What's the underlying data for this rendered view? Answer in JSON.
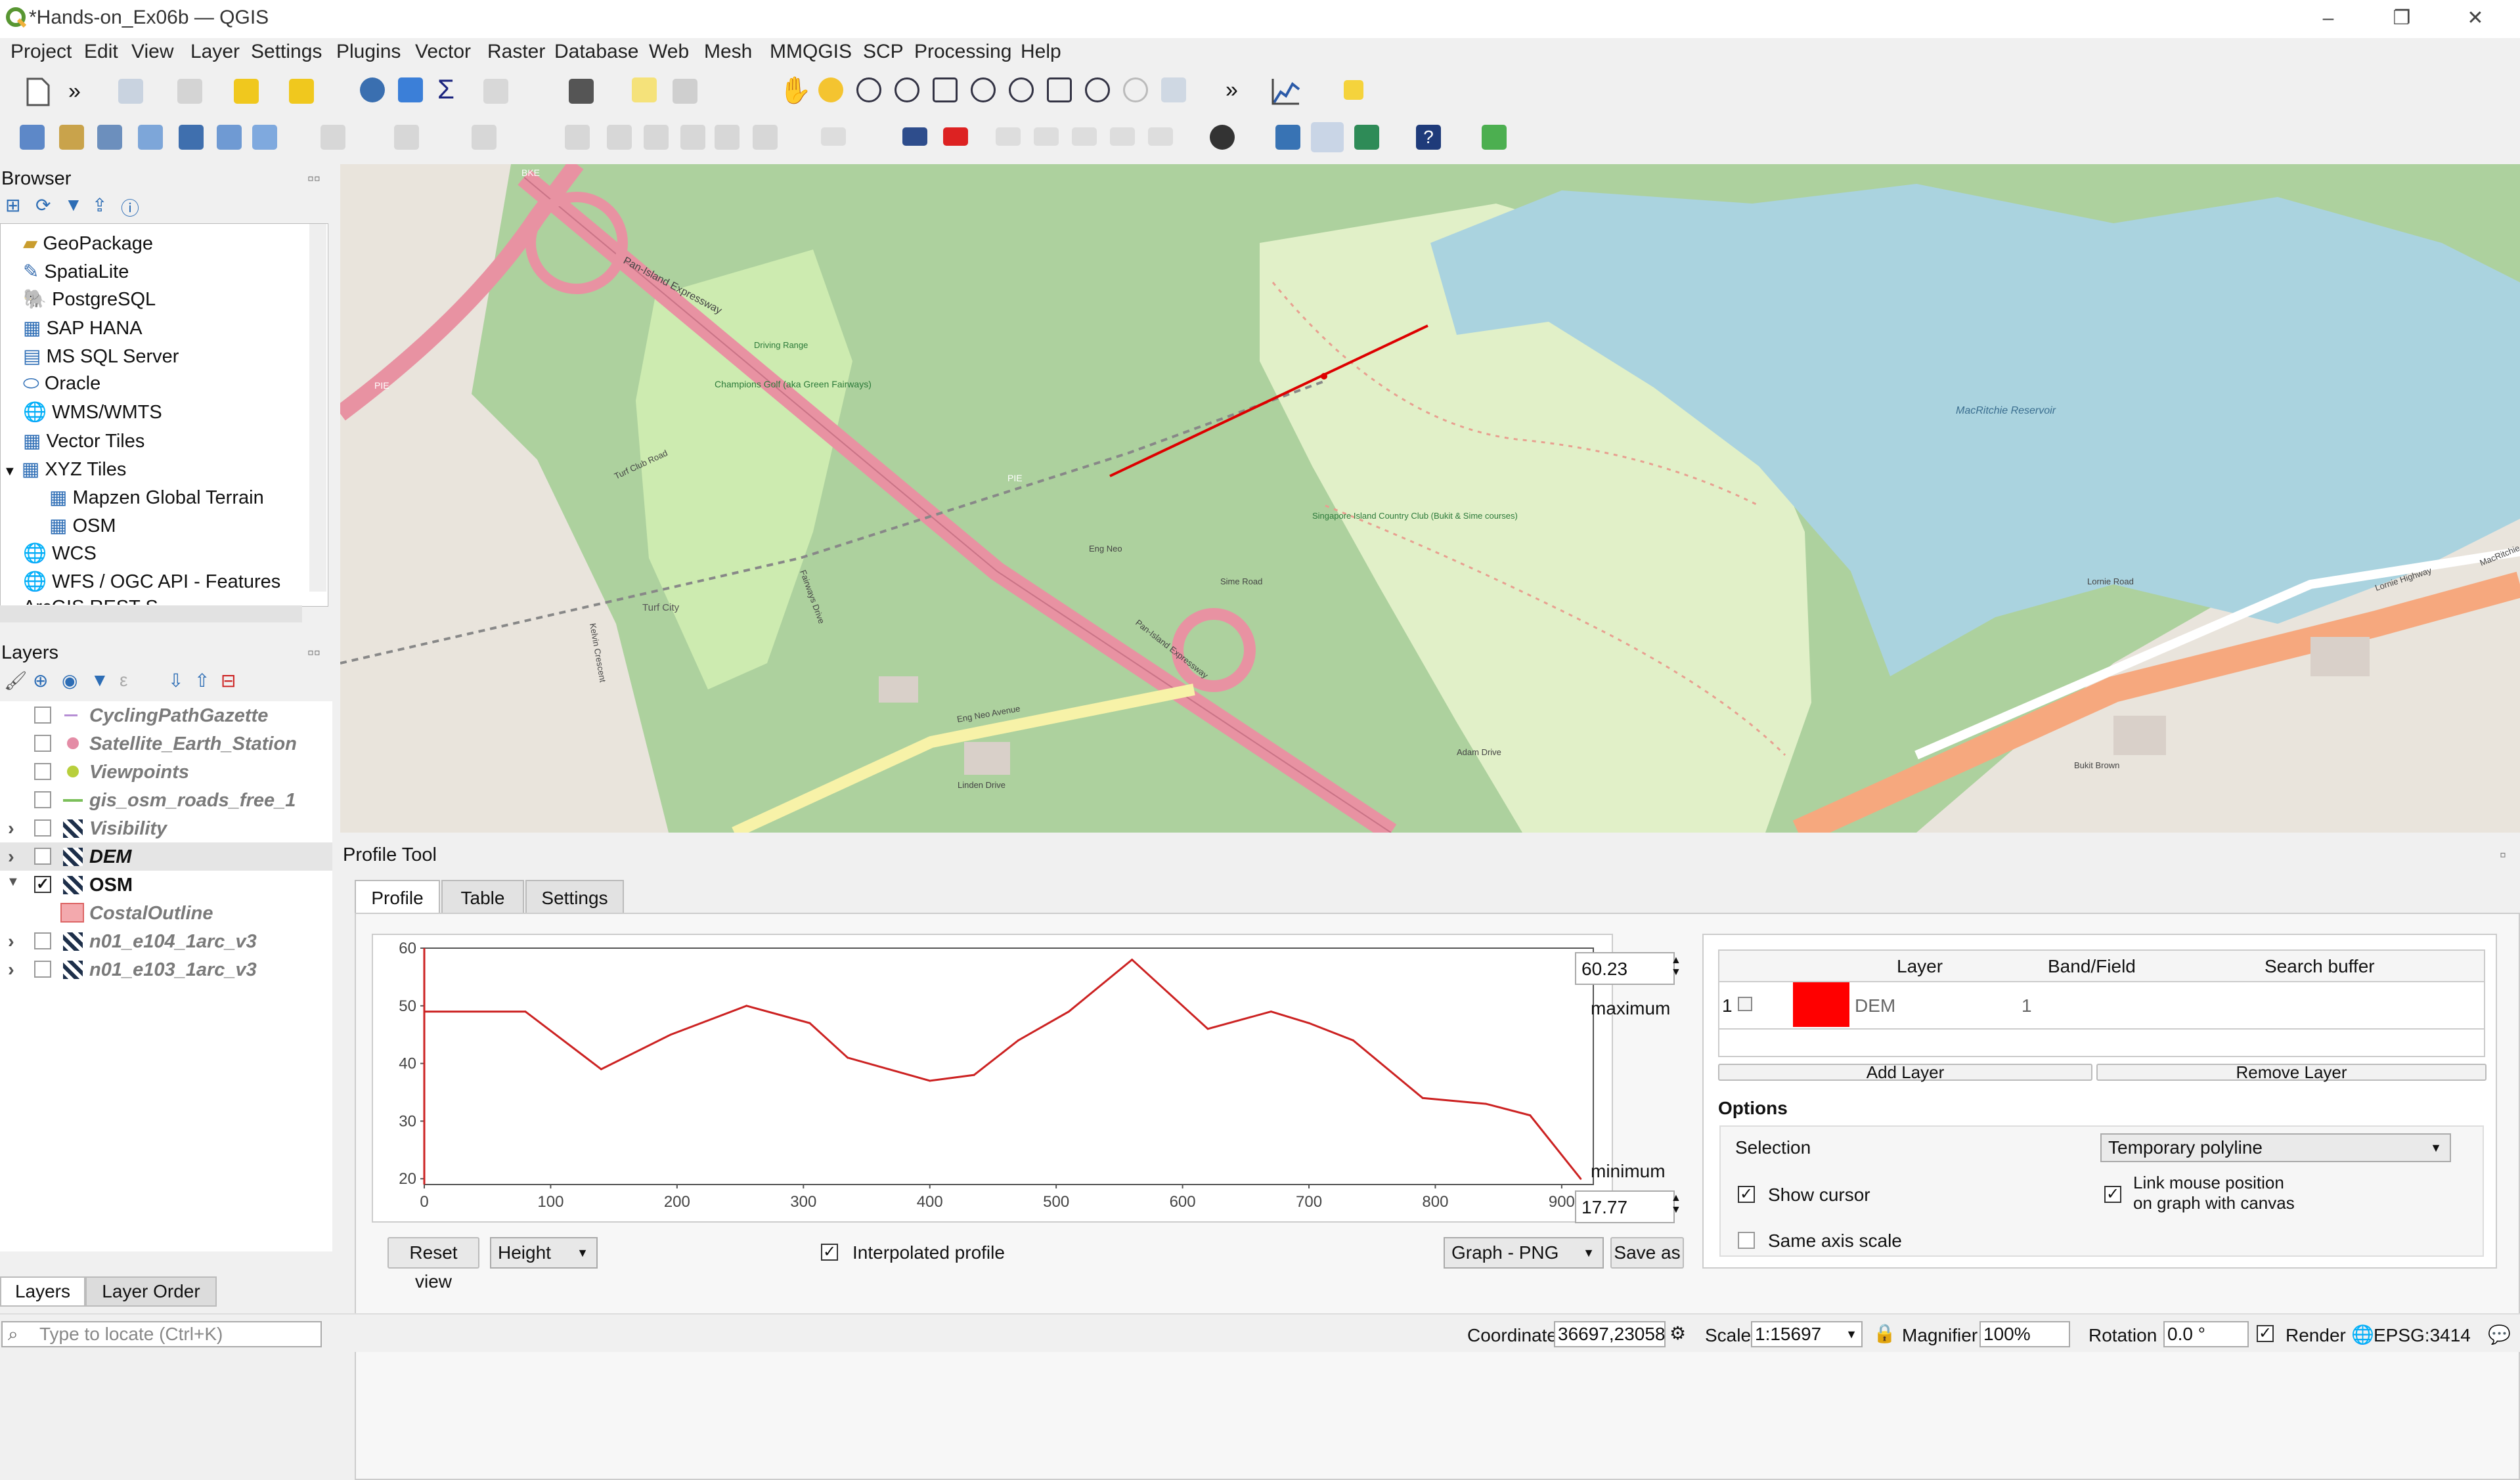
{
  "window": {
    "title": "*Hands-on_Ex06b — QGIS",
    "minimize": "–",
    "maximize": "❐",
    "close": "✕"
  },
  "menu": [
    "Project",
    "Edit",
    "View",
    "Layer",
    "Settings",
    "Plugins",
    "Vector",
    "Raster",
    "Database",
    "Web",
    "Mesh",
    "MMQGIS",
    "SCP",
    "Processing",
    "Help"
  ],
  "browser": {
    "title": "Browser",
    "items": [
      "GeoPackage",
      "SpatiaLite",
      "PostgreSQL",
      "SAP HANA",
      "MS SQL Server",
      "Oracle",
      "WMS/WMTS",
      "Vector Tiles",
      "XYZ Tiles",
      "Mapzen Global Terrain",
      "OSM",
      "WCS",
      "WFS / OGC API - Features",
      "ArcGIS REST S"
    ]
  },
  "layers": {
    "title": "Layers",
    "items": [
      {
        "name": "CyclingPathGazette",
        "checked": false
      },
      {
        "name": "Satellite_Earth_Station",
        "checked": false
      },
      {
        "name": "Viewpoints",
        "checked": false
      },
      {
        "name": "gis_osm_roads_free_1",
        "checked": false
      },
      {
        "name": "Visibility",
        "checked": false
      },
      {
        "name": "DEM",
        "checked": false
      },
      {
        "name": "OSM",
        "checked": true
      },
      {
        "name": "CostalOutline",
        "checked": false
      },
      {
        "name": "n01_e104_1arc_v3",
        "checked": false
      },
      {
        "name": "n01_e103_1arc_v3",
        "checked": false
      }
    ],
    "bottom_tabs": [
      "Layers",
      "Layer Order"
    ],
    "locator_placeholder": "Type to locate (Ctrl+K)"
  },
  "map": {
    "labels": {
      "pie1": "Pan-Island Expressway",
      "pie2": "PIE",
      "pie3": "PIE",
      "bke": "BKE",
      "golf1": "Champions Golf (aka Green Fairways)",
      "drive": "Driving Range",
      "turf": "Turf Club Road",
      "turfcity": "Turf City",
      "sicc": "Singapore Island Country Club (Bukit & Sime courses)",
      "reservoir": "MacRitchie Reservoir",
      "lornie": "Lornie Road",
      "lornie_hw": "Lornie Highway",
      "macritchie": "MacRitchie Viaduct",
      "eng_neo": "Eng Neo Avenue",
      "sime": "Sime Road",
      "adam": "Adam Drive",
      "linden": "Linden Drive",
      "fairways": "Fairways Drive",
      "kelvin": "Kelvin Crescent",
      "bukit_brown": "Bukit Brown",
      "eng_neo_2": "Eng Neo",
      "pan2": "Pan-Island Expressway"
    }
  },
  "profile": {
    "panel_title": "Profile Tool",
    "tabs": [
      "Profile",
      "Table",
      "Settings"
    ],
    "max_value": "60.23",
    "max_label": "maximum",
    "min_value": "17.77",
    "min_label": "minimum",
    "reset_view": "Reset view",
    "height_select": "Height",
    "interpolated": "Interpolated profile",
    "graph_select": "Graph - PNG",
    "save_as": "Save as",
    "table_headers": [
      "Layer",
      "Band/Field",
      "Search buffer"
    ],
    "table_row": {
      "index": "1",
      "layer": "DEM",
      "band": "1",
      "color": "#ff0000"
    },
    "add_layer": "Add Layer",
    "remove_layer": "Remove Layer",
    "options_title": "Options",
    "selection_label": "Selection",
    "selection_value": "Temporary polyline",
    "show_cursor": "Show cursor",
    "link_mouse": "Link mouse position on graph with canvas",
    "link_mouse_1": "Link mouse position",
    "link_mouse_2": "on graph with canvas",
    "same_axis": "Same axis scale"
  },
  "chart_data": {
    "type": "line",
    "x": [
      0,
      80,
      140,
      195,
      255,
      305,
      335,
      400,
      435,
      470,
      510,
      560,
      600,
      620,
      670,
      700,
      735,
      790,
      840,
      875,
      915
    ],
    "y": [
      49,
      49,
      39,
      45,
      50,
      47,
      41,
      37,
      38,
      44,
      49,
      58,
      50,
      46,
      49,
      47,
      44,
      34,
      33,
      31,
      20
    ],
    "xticks": [
      "0",
      "100",
      "200",
      "300",
      "400",
      "500",
      "600",
      "700",
      "800",
      "900"
    ],
    "yticks": [
      "20",
      "30",
      "40",
      "50",
      "60"
    ],
    "xlim": [
      0,
      925
    ],
    "ylim": [
      19,
      60
    ],
    "color": "#cc2222",
    "grid": false
  },
  "statusbar": {
    "coordinate_label": "Coordinate",
    "coordinate": "36697,23058",
    "scale_label": "Scale",
    "scale": "1:15697",
    "magnifier_label": "Magnifier",
    "magnifier": "100%",
    "rotation_label": "Rotation",
    "rotation": "0.0 °",
    "render": "Render",
    "crs": "EPSG:3414"
  }
}
